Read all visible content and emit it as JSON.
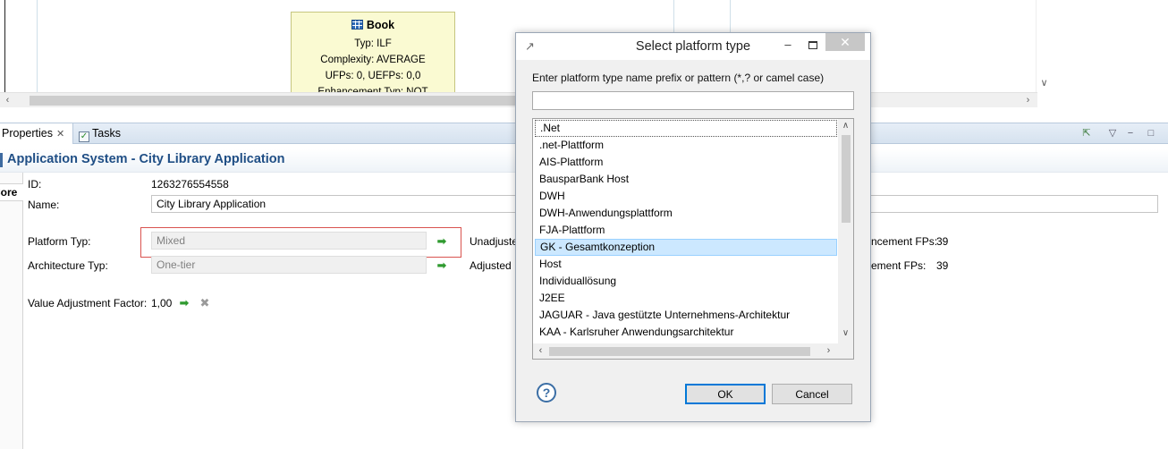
{
  "diagram": {
    "node": {
      "title": "Book",
      "lines": [
        "Typ: ILF",
        "Complexity: AVERAGE",
        "UFPs: 0, UEFPs: 0,0",
        "Enhancement Typ: NOT CHANGED"
      ]
    }
  },
  "tabs": [
    {
      "label": "Properties"
    },
    {
      "label": "Tasks"
    }
  ],
  "properties": {
    "header_title": "Application System - City Library Application",
    "side_label": "Core",
    "id_label": "ID:",
    "id_value": "1263276554558",
    "name_label": "Name:",
    "name_value": "City Library Application",
    "platform_label": "Platform Typ:",
    "platform_value": "Mixed",
    "architecture_label": "Architecture Typ:",
    "architecture_value": "One-tier",
    "vaf_label": "Value Adjustment Factor:",
    "vaf_value": "1,00",
    "unadjusted_label": "Unadjuste",
    "adjusted_label": "Adjusted",
    "enh1_label": "ncement FPs:",
    "enh1_value": "39",
    "enh2_label": "ement FPs:",
    "enh2_value": "39"
  },
  "dialog": {
    "title": "Select platform type",
    "prompt": "Enter platform type name prefix or pattern (*,? or camel case)",
    "filter_value": "",
    "items": [
      ".Net",
      ".net-Plattform",
      "AIS-Plattform",
      "BausparBank Host",
      "DWH",
      "DWH-Anwendungsplattform",
      "FJA-Plattform",
      "GK - Gesamtkonzeption",
      "Host",
      "Individuallösung",
      "J2EE",
      "JAGUAR - Java gestützte Unternehmens-Architektur",
      "KAA - Karlsruher Anwendungsarchitektur"
    ],
    "selected_index": 7,
    "ok_label": "OK",
    "cancel_label": "Cancel"
  },
  "colors": {
    "header_text": "#1f4e85",
    "selection": "#cce8ff",
    "node_fill": "#fafad2",
    "highlight_border": "#d9534f"
  },
  "icons": {
    "entity": "table-icon",
    "goto": "arrow-right-icon",
    "remove": "cross-icon",
    "help": "question-icon"
  }
}
